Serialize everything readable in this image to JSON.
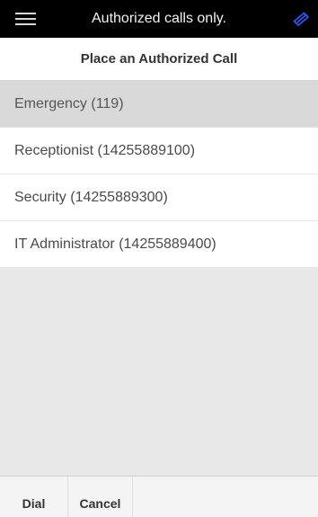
{
  "topbar": {
    "title": "Authorized calls only.",
    "menu_icon": "hamburger-menu-icon",
    "status_icon": "link-icon",
    "accent_color": "#2b5cff"
  },
  "header": {
    "title": "Place an Authorized Call"
  },
  "contacts": {
    "items": [
      {
        "label": "Emergency (119)",
        "selected": true
      },
      {
        "label": "Receptionist (14255889100)",
        "selected": false
      },
      {
        "label": "Security (14255889300)",
        "selected": false
      },
      {
        "label": "IT Administrator (14255889400)",
        "selected": false
      }
    ]
  },
  "footer": {
    "dial_label": "Dial",
    "cancel_label": "Cancel"
  }
}
